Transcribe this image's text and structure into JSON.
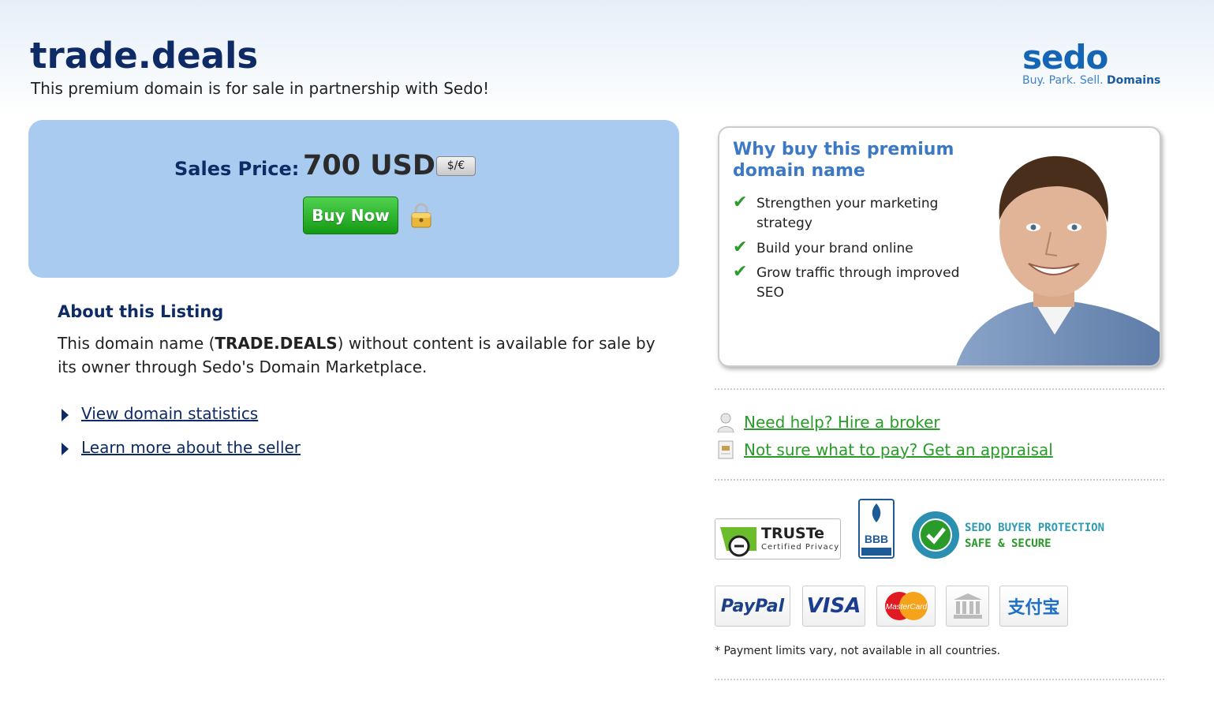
{
  "header": {
    "domain": "trade.deals",
    "subtitle": "This premium domain is for sale in partnership with Sedo!",
    "logo_word": "sedo",
    "logo_tagline_a": "Buy. Park. Sell.",
    "logo_tagline_b": "Domains"
  },
  "price_box": {
    "label": "Sales Price:",
    "price": "700 USD",
    "currency_toggle": "$/€",
    "buy_button": "Buy Now"
  },
  "about": {
    "title": "About this Listing",
    "text_before": "This domain name (",
    "domain_caps": "TRADE.DEALS",
    "text_after": ") without content is available for sale by its owner through Sedo's Domain Marketplace.",
    "links": [
      "View domain statistics",
      "Learn more about the seller"
    ]
  },
  "promo": {
    "title": "Why buy this premium domain name",
    "items": [
      "Strengthen your marketing strategy",
      "Build your brand online",
      "Grow traffic through improved SEO"
    ]
  },
  "help": {
    "broker": "Need help? Hire a broker",
    "appraisal": "Not sure what to pay? Get an appraisal"
  },
  "trust": {
    "truste_name": "TRUSTe",
    "truste_sub": "Certified Privacy",
    "bbb": "BBB",
    "protection_line1": "SEDO BUYER PROTECTION",
    "protection_line2": "SAFE & SECURE"
  },
  "payments": {
    "paypal": "PayPal",
    "visa": "VISA",
    "mastercard": "MasterCard",
    "alipay": "支付宝",
    "footnote": "* Payment limits vary, not available in all countries."
  },
  "colors": {
    "navy": "#0e2b66",
    "price_box_bg": "#a8cbef",
    "buy_green": "#1fa51f",
    "link_green": "#279d27",
    "promo_blue": "#3c78c4"
  }
}
